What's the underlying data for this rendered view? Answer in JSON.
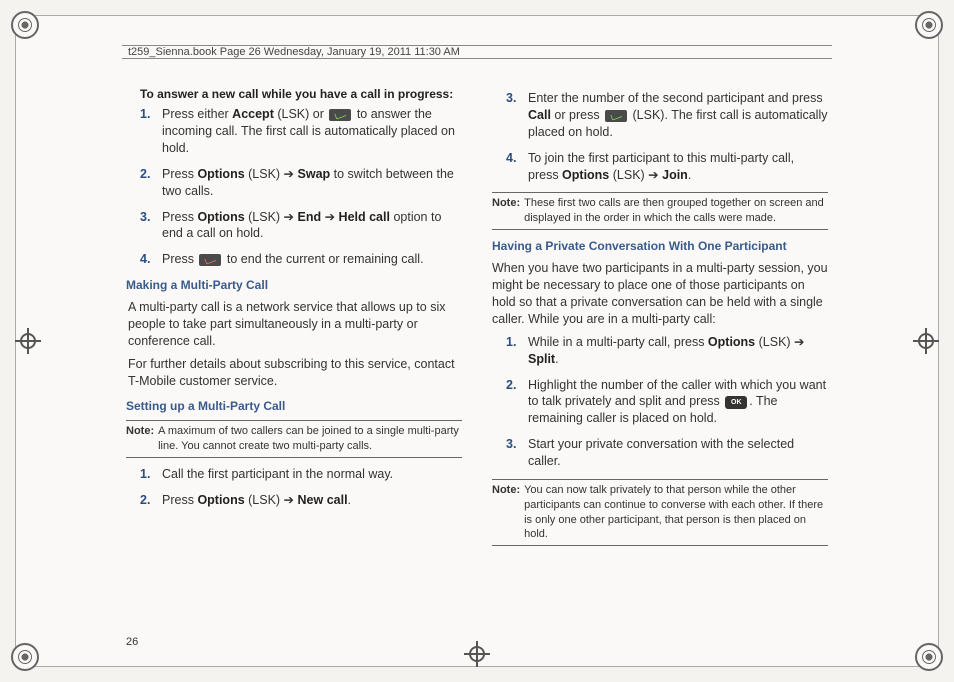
{
  "header": "t259_Sienna.book  Page 26  Wednesday, January 19, 2011  11:30 AM",
  "page_number": "26",
  "left": {
    "title1": "To answer a new call while you have a call in progress:",
    "steps1": [
      {
        "pre": "Press either ",
        "b1": "Accept",
        "mid": " (LSK) or ",
        "icon": "green",
        "post": " to answer the incoming call. The first call is automatically placed on hold."
      },
      {
        "pre": "Press ",
        "b1": "Options",
        "mid": " (LSK) ➔ ",
        "b2": "Swap",
        "post": " to switch between the two calls."
      },
      {
        "pre": "Press ",
        "b1": "Options",
        "mid": " (LSK) ➔ ",
        "b2": "End",
        "mid2": " ➔ ",
        "b3": "Held call",
        "post": " option to end a call on hold."
      },
      {
        "pre": "Press ",
        "icon": "red",
        "post": " to end the current or remaining call."
      }
    ],
    "blue1": "Making a Multi-Party Call",
    "para1": "A multi-party call is a network service that allows up to six people to take part simultaneously in a multi-party or conference call.",
    "para2": "For further details about subscribing to this service, contact T-Mobile customer service.",
    "blue2": "Setting up a Multi-Party Call",
    "note1_label": "Note:",
    "note1": "A maximum of two callers can be joined to a single multi-party line. You cannot create two multi-party calls.",
    "steps2": [
      {
        "pre": "Call the first participant in the normal way."
      },
      {
        "pre": "Press ",
        "b1": "Options",
        "mid": " (LSK) ➔ ",
        "b2": "New call",
        "post": "."
      }
    ]
  },
  "right": {
    "steps3_start": 3,
    "steps3": [
      {
        "pre": "Enter the number of the second participant and press ",
        "icon": "green",
        "mid": " or press ",
        "b1": "Call",
        "post": " (LSK). The first call is automatically placed on hold."
      },
      {
        "pre": "To join the first participant to this multi-party call, press ",
        "b1": "Options",
        "mid": " (LSK) ➔ ",
        "b2": "Join",
        "post": "."
      }
    ],
    "note2_label": "Note:",
    "note2": "These first two calls are then grouped together on screen and displayed in the order in which the calls were made.",
    "blue3": "Having a Private Conversation With One Participant",
    "para3": "When you have two participants in a multi-party session, you might be necessary to place one of those participants on hold so that a private conversation can be held with a single caller. While you are in a multi-party call:",
    "steps4": [
      {
        "pre": "While in a multi-party call, press ",
        "b1": "Options",
        "mid": " (LSK) ➔ ",
        "b2": "Split",
        "post": "."
      },
      {
        "pre": "Highlight the number of the caller with which you want to talk privately and split and press ",
        "ok": true,
        "post": ". The remaining caller is placed on hold."
      },
      {
        "pre": "Start your private conversation with the selected caller."
      }
    ],
    "note3_label": "Note:",
    "note3": "You can now talk privately to that person while the other participants can continue to converse with each other. If there is only one other participant, that person is then placed on hold."
  }
}
